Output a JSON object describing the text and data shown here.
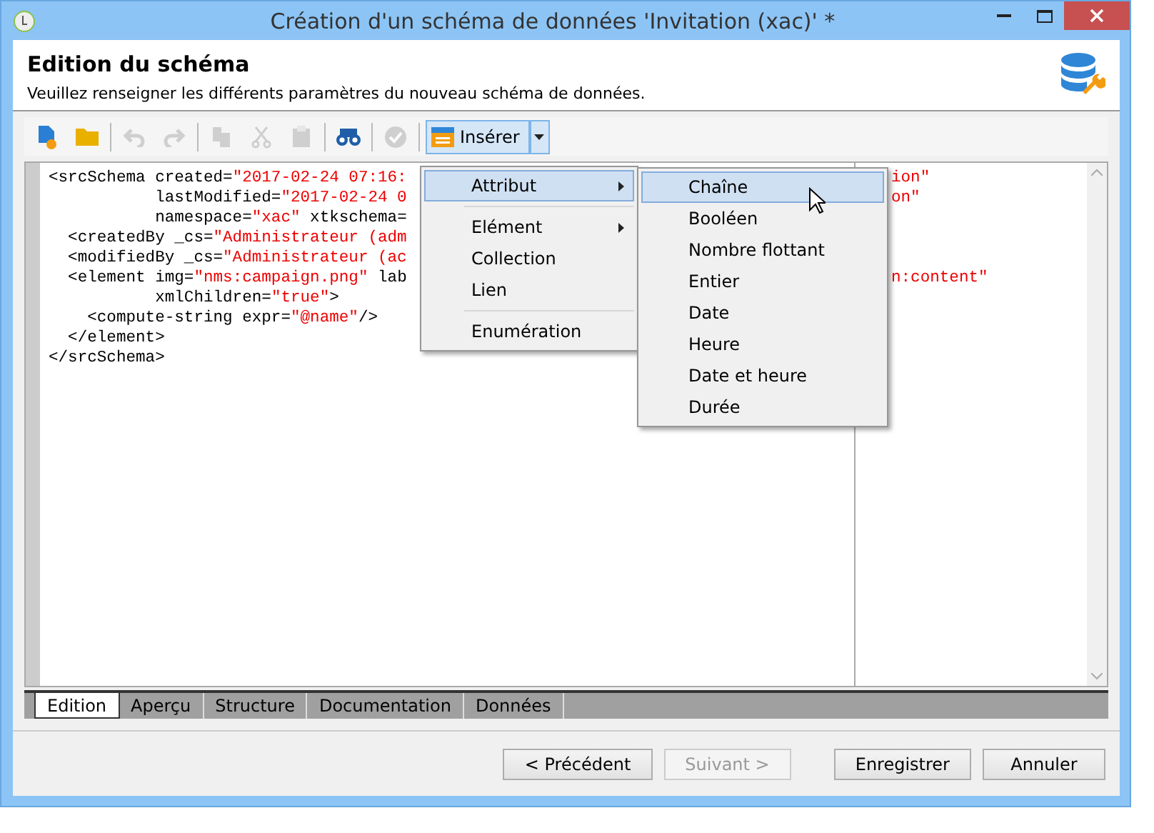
{
  "window": {
    "title": "Création d'un schéma de données 'Invitation (xac)' *"
  },
  "header": {
    "title": "Edition du schéma",
    "subtitle": "Veuillez renseigner les différents paramètres du nouveau schéma de données."
  },
  "toolbar": [
    {
      "kind": "new",
      "disabled": false
    },
    {
      "kind": "open",
      "disabled": false
    },
    {
      "kind": "sep"
    },
    {
      "kind": "undo",
      "disabled": true
    },
    {
      "kind": "redo",
      "disabled": true
    },
    {
      "kind": "sep"
    },
    {
      "kind": "copy",
      "disabled": true
    },
    {
      "kind": "cut",
      "disabled": true
    },
    {
      "kind": "paste",
      "disabled": true
    },
    {
      "kind": "sep"
    },
    {
      "kind": "find",
      "disabled": false
    },
    {
      "kind": "sep"
    },
    {
      "kind": "check",
      "disabled": true
    },
    {
      "kind": "sep"
    },
    {
      "kind": "insert",
      "label": "Insérer",
      "pressed": true
    }
  ],
  "code": [
    {
      "segments": [
        {
          "kind": "tag",
          "text": "<srcSchema created="
        },
        {
          "kind": "value",
          "text": "\"2017-02-24 07:16:"
        }
      ],
      "tail": {
        "kind": "value",
        "text": "ion\""
      }
    },
    {
      "segments": [
        {
          "kind": "tag",
          "text": "           lastModified="
        },
        {
          "kind": "value",
          "text": "\"2017-02-24 0"
        }
      ],
      "tail": {
        "kind": "value",
        "text": "on\""
      }
    },
    {
      "segments": [
        {
          "kind": "tag",
          "text": "           namespace="
        },
        {
          "kind": "value",
          "text": "\"xac\""
        },
        {
          "kind": "tag",
          "text": " xtkschema="
        }
      ]
    },
    {
      "segments": [
        {
          "kind": "tag",
          "text": "  <createdBy _cs="
        },
        {
          "kind": "value",
          "text": "\"Administrateur (adm"
        }
      ]
    },
    {
      "segments": [
        {
          "kind": "tag",
          "text": "  <modifiedBy _cs="
        },
        {
          "kind": "value",
          "text": "\"Administrateur (ac"
        }
      ]
    },
    {
      "segments": [
        {
          "kind": "tag",
          "text": "  <element img="
        },
        {
          "kind": "value",
          "text": "\"nms:campaign.png\""
        },
        {
          "kind": "tag",
          "text": " lab"
        }
      ],
      "tail": {
        "kind": "value",
        "text": "n:content\""
      }
    },
    {
      "segments": [
        {
          "kind": "tag",
          "text": "           xmlChildren="
        },
        {
          "kind": "value",
          "text": "\"true\""
        },
        {
          "kind": "tag",
          "text": ">"
        }
      ]
    },
    {
      "segments": [
        {
          "kind": "tag",
          "text": "    <compute-string expr="
        },
        {
          "kind": "value",
          "text": "\"@name\""
        },
        {
          "kind": "tag",
          "text": "/>"
        }
      ]
    },
    {
      "segments": [
        {
          "kind": "tag",
          "text": "  </element>"
        }
      ]
    },
    {
      "segments": [
        {
          "kind": "tag",
          "text": "</srcSchema>"
        }
      ]
    }
  ],
  "tabs": [
    {
      "label": "Edition",
      "selected": true
    },
    {
      "label": "Aperçu",
      "selected": false
    },
    {
      "label": "Structure",
      "selected": false
    },
    {
      "label": "Documentation",
      "selected": false
    },
    {
      "label": "Données",
      "selected": false
    }
  ],
  "buttons": [
    {
      "label": "< Précédent",
      "disabled": false
    },
    {
      "label": "Suivant >",
      "disabled": true
    },
    {
      "label": "Enregistrer",
      "disabled": false
    },
    {
      "label": "Annuler",
      "disabled": false
    }
  ],
  "menu": [
    {
      "kind": "item",
      "label": "Attribut",
      "submenu": true,
      "selected": true
    },
    {
      "kind": "sep"
    },
    {
      "kind": "item",
      "label": "Elément",
      "submenu": true,
      "selected": false
    },
    {
      "kind": "item",
      "label": "Collection",
      "submenu": false,
      "selected": false
    },
    {
      "kind": "item",
      "label": "Lien",
      "submenu": false,
      "selected": false
    },
    {
      "kind": "sep"
    },
    {
      "kind": "item",
      "label": "Enumération",
      "submenu": false,
      "selected": false
    }
  ],
  "submenu": [
    {
      "label": "Chaîne",
      "selected": true
    },
    {
      "label": "Booléen",
      "selected": false
    },
    {
      "label": "Nombre flottant",
      "selected": false
    },
    {
      "label": "Entier",
      "selected": false
    },
    {
      "label": "Date",
      "selected": false
    },
    {
      "label": "Heure",
      "selected": false
    },
    {
      "label": "Date et heure",
      "selected": false
    },
    {
      "label": "Durée",
      "selected": false
    }
  ]
}
